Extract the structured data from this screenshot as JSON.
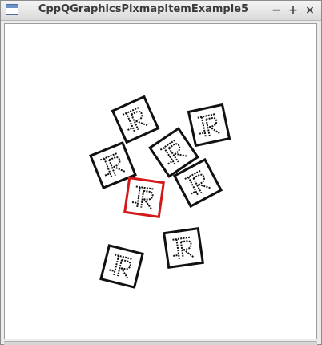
{
  "window": {
    "title": "CppQGraphicsPixmapItemExample5",
    "buttons": {
      "minimize": "−",
      "maximize": "+",
      "close": "×"
    },
    "icon": "window-app-icon"
  },
  "scene": {
    "background": "#ffffff",
    "item_border_color": "#111111",
    "selected_border_color": "#d21818",
    "items": [
      {
        "glyph": "R"
      },
      {
        "glyph": "R"
      },
      {
        "glyph": "R"
      },
      {
        "glyph": "R"
      },
      {
        "glyph": "R",
        "selected": true
      },
      {
        "glyph": "R"
      },
      {
        "glyph": "R"
      },
      {
        "glyph": "R"
      }
    ]
  }
}
